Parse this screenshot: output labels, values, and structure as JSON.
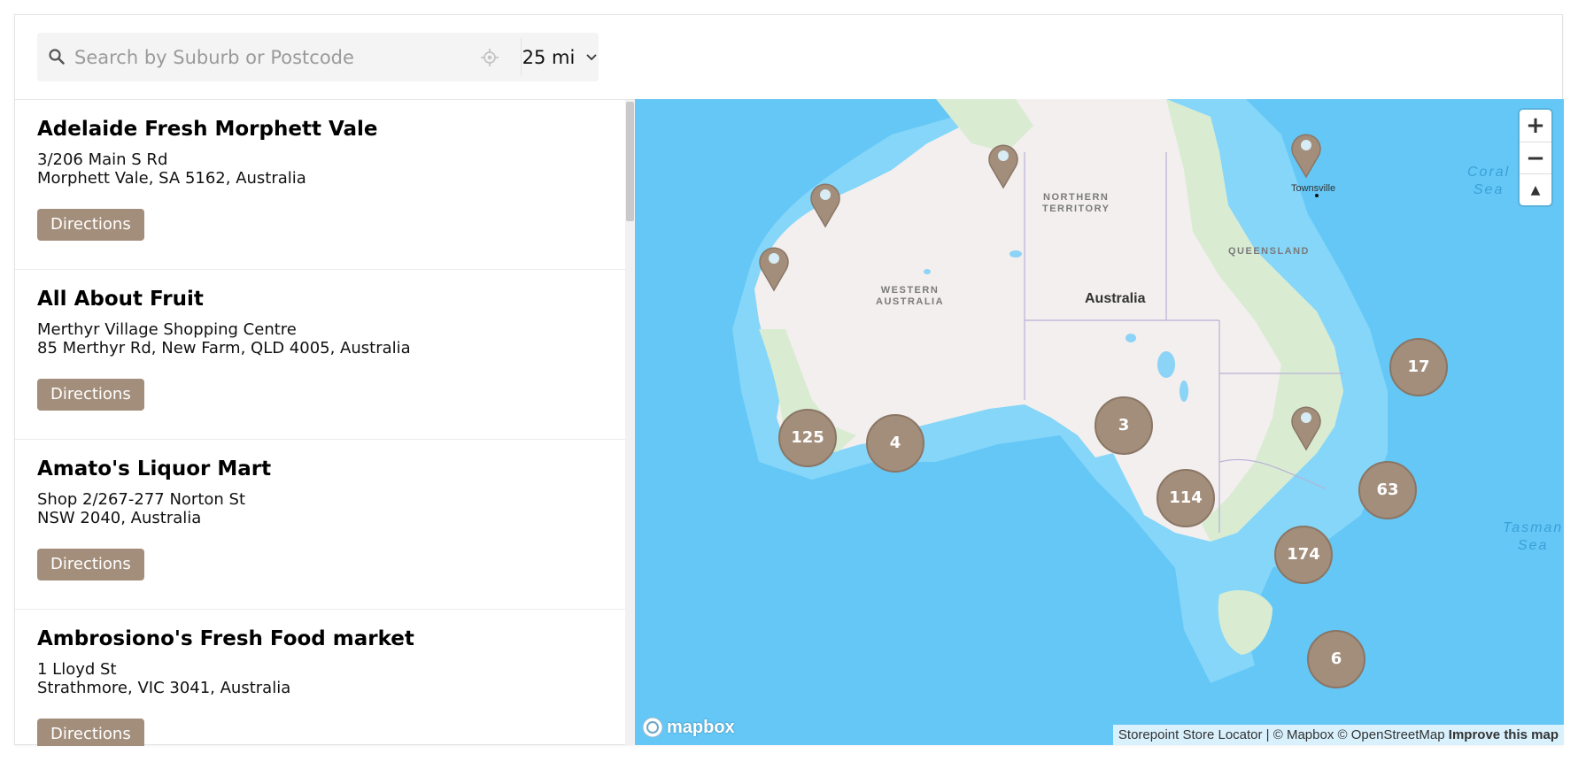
{
  "search": {
    "placeholder": "Search by Suburb or Postcode",
    "value": "",
    "radius_value": "25 mi",
    "radius_options": [
      "25 mi"
    ]
  },
  "stores": [
    {
      "name": "Adelaide Fresh Morphett Vale",
      "address_line1": "3/206 Main S Rd",
      "address_line2": "Morphett Vale, SA 5162, Australia",
      "directions_label": "Directions"
    },
    {
      "name": "All About Fruit",
      "address_line1": "Merthyr Village Shopping Centre",
      "address_line2": "85 Merthyr Rd, New Farm, QLD 4005, Australia",
      "directions_label": "Directions"
    },
    {
      "name": "Amato's Liquor Mart",
      "address_line1": "Shop 2/267-277 Norton St",
      "address_line2": "NSW 2040, Australia",
      "directions_label": "Directions"
    },
    {
      "name": "Ambrosiono's Fresh Food market",
      "address_line1": "1 Lloyd St",
      "address_line2": "Strathmore, VIC 3041, Australia",
      "directions_label": "Directions"
    }
  ],
  "map": {
    "country_label": "Australia",
    "regions": {
      "northern_territory": [
        "NORTHERN",
        "TERRITORY"
      ],
      "western_australia": [
        "WESTERN",
        "AUSTRALIA"
      ],
      "queensland": "QUEENSLAND"
    },
    "seas": {
      "coral": [
        "Coral",
        "Sea"
      ],
      "tasman": [
        "Tasman",
        "Sea"
      ]
    },
    "city": "Townsville",
    "clusters": [
      "125",
      "4",
      "3",
      "114",
      "174",
      "17",
      "63",
      "6"
    ],
    "marker_color": "#a38e7b",
    "water_color": "#64c7f6",
    "land_color": "#f2efee",
    "zoom_in_label": "+",
    "zoom_out_label": "−",
    "compass_label": "▲",
    "logo_text": "mapbox",
    "attribution": {
      "text": "Storepoint Store Locator | © Mapbox © OpenStreetMap",
      "improve": "Improve this map"
    }
  },
  "colors": {
    "button_bg": "#a38e7b",
    "button_text": "#ffffff"
  }
}
